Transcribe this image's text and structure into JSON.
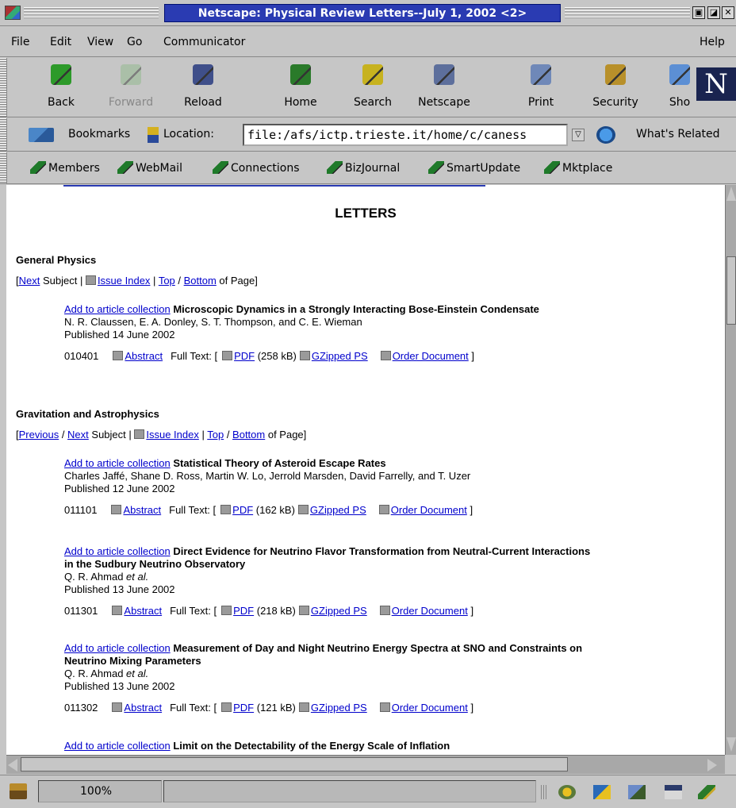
{
  "window": {
    "title": "Netscape: Physical Review Letters--July 1, 2002 <2>",
    "controls": [
      "▣",
      "◪",
      "✕"
    ]
  },
  "menu": [
    "File",
    "Edit",
    "View",
    "Go",
    "Communicator",
    "Help"
  ],
  "toolbar": [
    {
      "label": "Back",
      "icon": "back-arrow-icon",
      "color": "#2d9a2a",
      "disabled": false
    },
    {
      "label": "Forward",
      "icon": "forward-arrow-icon",
      "color": "#8fb88a",
      "disabled": true
    },
    {
      "label": "Reload",
      "icon": "reload-icon",
      "color": "#3f4f8a",
      "disabled": false
    },
    {
      "label": "Home",
      "icon": "home-icon",
      "color": "#2a7a2a",
      "disabled": false
    },
    {
      "label": "Search",
      "icon": "search-icon",
      "color": "#c7b21f",
      "disabled": false
    },
    {
      "label": "Netscape",
      "icon": "my-netscape-icon",
      "color": "#5d6f9c",
      "disabled": false
    },
    {
      "label": "Print",
      "icon": "print-icon",
      "color": "#6f88b8",
      "disabled": false
    },
    {
      "label": "Security",
      "icon": "lock-icon",
      "color": "#b8902a",
      "disabled": false
    },
    {
      "label": "Sho",
      "icon": "shop-icon",
      "color": "#5c8fd4",
      "disabled": false
    }
  ],
  "location": {
    "bookmarks_label": "Bookmarks",
    "location_label": "Location:",
    "url": "file:/afs/ictp.trieste.it/home/c/caness",
    "related_label": "What's Related"
  },
  "personal": [
    "Members",
    "WebMail",
    "Connections",
    "BizJournal",
    "SmartUpdate",
    "Mktplace"
  ],
  "page": {
    "heading": "LETTERS",
    "sections": [
      {
        "name": "General Physics",
        "nav": {
          "open": "[",
          "prev": "",
          "sep": "",
          "next": "Next",
          "subject": " Subject | ",
          "index": "Issue Index",
          "bar": " | ",
          "top": "Top",
          "slash": " / ",
          "bottom": "Bottom",
          "of": " of Page]"
        }
      },
      {
        "name": "Gravitation and Astrophysics",
        "nav": {
          "open": "[",
          "prev": "Previous",
          "sep": " / ",
          "next": "Next",
          "subject": " Subject | ",
          "index": "Issue Index",
          "bar": " | ",
          "top": "Top",
          "slash": " / ",
          "bottom": "Bottom",
          "of": " of Page]"
        }
      }
    ],
    "articles": [
      {
        "add": "Add to article collection",
        "title": "Microscopic Dynamics in a Strongly Interacting Bose-Einstein Condensate",
        "title2": "",
        "authors": "N. R. Claussen, E. A. Donley, S. T. Thompson, and C. E. Wieman",
        "etal": "",
        "published": "Published 14 June 2002",
        "code": "010401",
        "abstract": "Abstract",
        "fulltext": "Full Text: [",
        "pdf": "PDF",
        "size": "(258 kB)",
        "gz": "GZipped PS",
        "order": "Order Document",
        "close": "]"
      },
      {
        "add": "Add to article collection",
        "title": "Statistical Theory of Asteroid Escape Rates",
        "title2": "",
        "authors": "Charles Jaffé, Shane D. Ross, Martin W. Lo, Jerrold Marsden, David Farrelly, and T. Uzer",
        "etal": "",
        "published": "Published 12 June 2002",
        "code": "011101",
        "abstract": "Abstract",
        "fulltext": "Full Text: [",
        "pdf": "PDF",
        "size": "(162 kB)",
        "gz": "GZipped PS",
        "order": "Order Document",
        "close": "]"
      },
      {
        "add": "Add to article collection",
        "title": "Direct Evidence for Neutrino Flavor Transformation from Neutral-Current Interactions",
        "title2": "in the Sudbury Neutrino Observatory",
        "authors": "Q. R. Ahmad ",
        "etal": "et al.",
        "published": "Published 13 June 2002",
        "code": "011301",
        "abstract": "Abstract",
        "fulltext": "Full Text: [",
        "pdf": "PDF",
        "size": "(218 kB)",
        "gz": "GZipped PS",
        "order": "Order Document",
        "close": "]"
      },
      {
        "add": "Add to article collection",
        "title": "Measurement of Day and Night Neutrino Energy Spectra at SNO and Constraints on",
        "title2": "Neutrino Mixing Parameters",
        "authors": "Q. R. Ahmad ",
        "etal": "et al.",
        "published": "Published 13 June 2002",
        "code": "011302",
        "abstract": "Abstract",
        "fulltext": "Full Text: [",
        "pdf": "PDF",
        "size": "(121 kB)",
        "gz": "GZipped PS",
        "order": "Order Document",
        "close": "]"
      },
      {
        "add": "Add to article collection",
        "title": "Limit on the Detectability of the Energy Scale of Inflation",
        "title2": "",
        "authors": "",
        "etal": "",
        "published": "",
        "code": "",
        "abstract": "",
        "fulltext": "",
        "pdf": "",
        "size": "",
        "gz": "",
        "order": "",
        "close": ""
      }
    ]
  },
  "status": {
    "zoom": "100%"
  }
}
